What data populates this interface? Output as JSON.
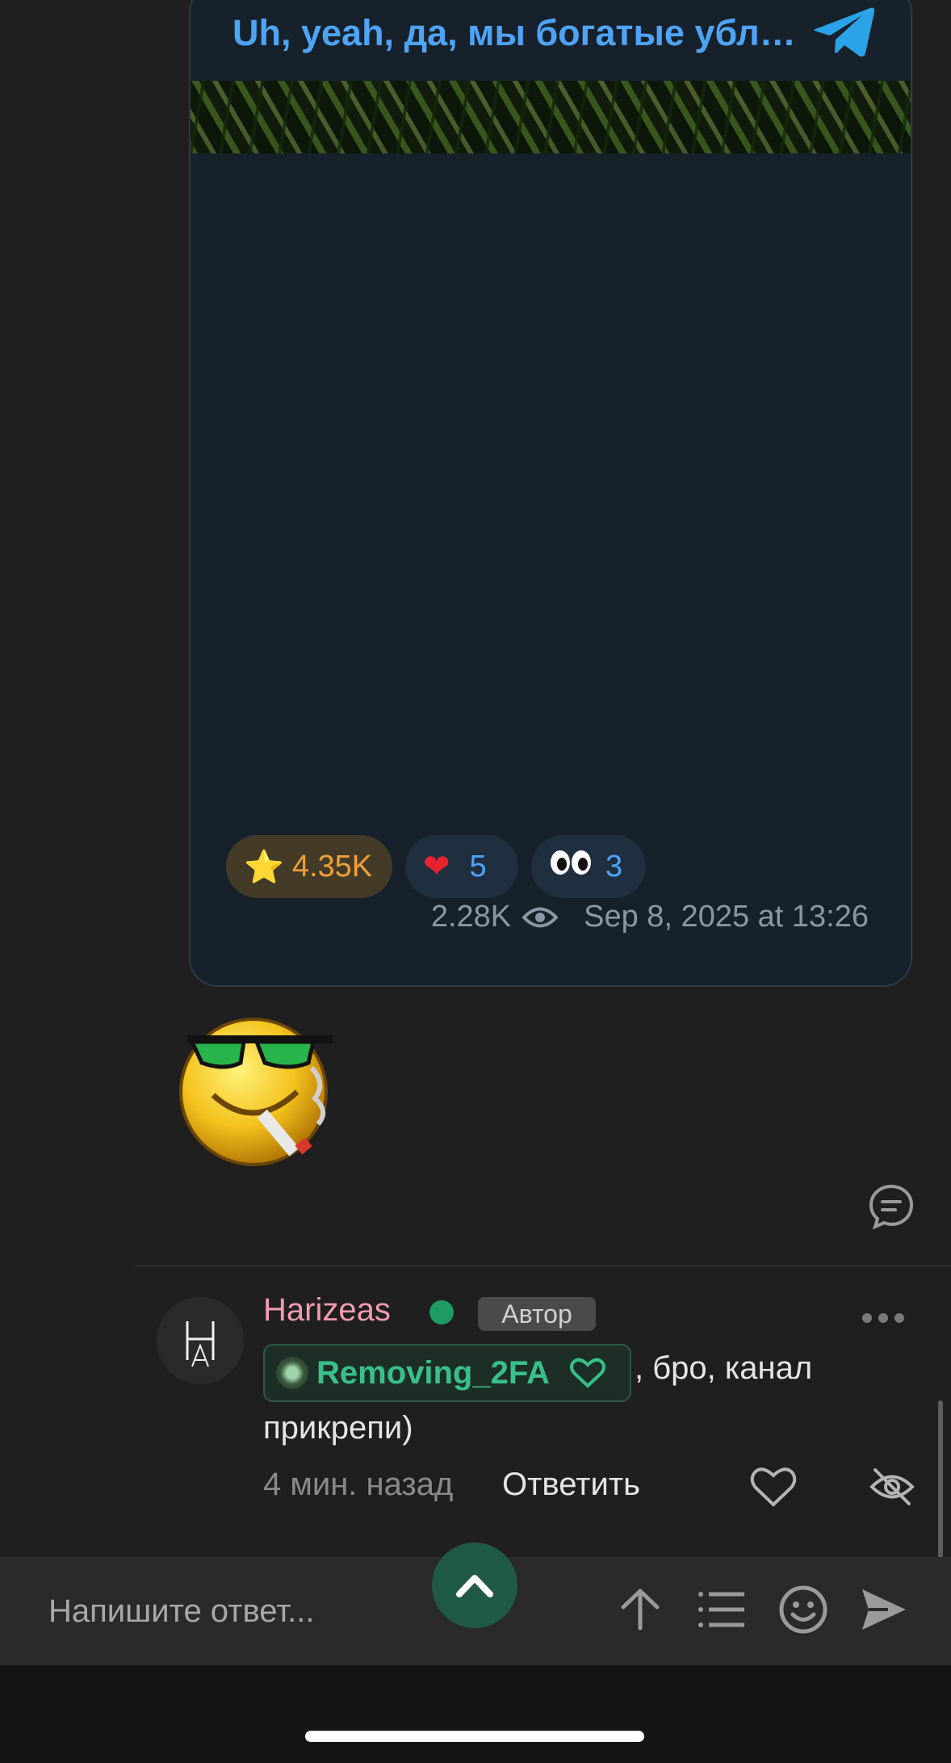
{
  "telegram_post": {
    "title": "Uh, yeah, да, мы богатые ублюдки",
    "reactions": [
      {
        "icon": "star-icon",
        "emoji": "⭐",
        "count": "4.35K"
      },
      {
        "icon": "heart-icon",
        "emoji": "❤",
        "count": "5"
      },
      {
        "icon": "eyes-icon",
        "emoji": "👀",
        "count": "3"
      }
    ],
    "views": "2.28K",
    "date": "Sep 8, 2025 at 13:26"
  },
  "comment": {
    "author": "Harizeas",
    "author_badge": "Автор",
    "avatar_letters": "HA",
    "mention": "Removing_2FA",
    "text_line1": ", бро, канал",
    "text_line2": "прикрепи)",
    "time": "4 мин. назад",
    "reply_label": "Ответить"
  },
  "input": {
    "placeholder": "Напишите ответ..."
  },
  "colors": {
    "telegram_blue": "#4ea4f6",
    "author_pink": "#f19cb0",
    "online_green": "#1e9c64",
    "mention_green": "#39c08a",
    "star_orange": "#f0a035"
  }
}
